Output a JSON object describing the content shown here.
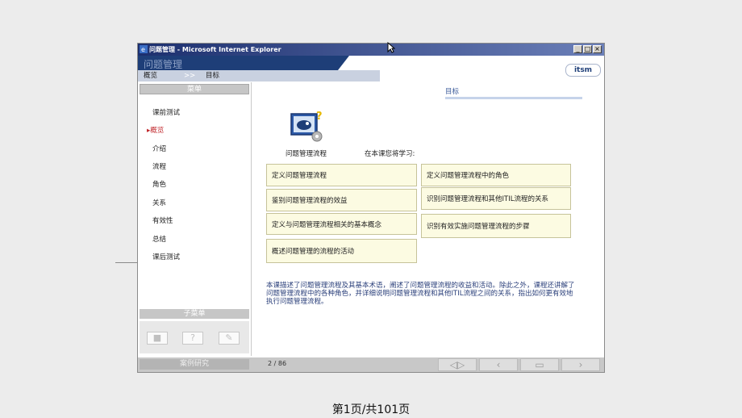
{
  "window": {
    "title": "问题管理 - Microsoft Internet Explorer",
    "controls": [
      "_",
      "□",
      "×"
    ]
  },
  "header": {
    "app_title": "问题管理",
    "breadcrumb": {
      "root": "概览",
      "separator": ">>",
      "current": "目标"
    },
    "logo": "itsm"
  },
  "sidebar": {
    "heading": "菜单",
    "items": [
      {
        "label": "课前测试",
        "active": false
      },
      {
        "label": "▸概览",
        "active": true
      },
      {
        "label": "介绍",
        "active": false
      },
      {
        "label": "流程",
        "active": false
      },
      {
        "label": "角色",
        "active": false
      },
      {
        "label": "关系",
        "active": false
      },
      {
        "label": "有效性",
        "active": false
      },
      {
        "label": "总结",
        "active": false
      },
      {
        "label": "课后测试",
        "active": false
      }
    ],
    "submenu_heading": "子菜单",
    "tool_icons": [
      "notes-icon",
      "help-icon",
      "tools-icon"
    ]
  },
  "main": {
    "section_title": "目标",
    "course_label": "问题管理流程",
    "intro": "在本课您将学习:",
    "objectives": [
      "定义问题管理流程",
      "定义问题管理流程中的角色",
      "鉴别问题管理流程的效益",
      "识别问题管理流程和其他ITIL流程的关系",
      "定义与问题管理流程相关的基本概念",
      "识别有效实施问题管理流程的步骤",
      "概述问题管理的流程的活动"
    ],
    "description": "本课描述了问题管理流程及其基本术语，阐述了问题管理流程的收益和活动。除此之外，课程还讲解了问题管理流程中的各种角色，并详细说明问题管理流程和其他ITIL流程之间的关系，指出如何更有效地执行问题管理流程。"
  },
  "statusbar": {
    "case_study": "案例研究",
    "page_indicator": "2 / 86",
    "nav_icons": [
      "audio-icon",
      "back-icon",
      "menu-icon",
      "next-icon"
    ]
  },
  "slide_footer": "第1页/共101页",
  "colors": {
    "title_bar": "#1c2f6e",
    "banner": "#1e3e78",
    "active_menu": "#c0262b",
    "objective_bg": "#fcfbe2"
  }
}
